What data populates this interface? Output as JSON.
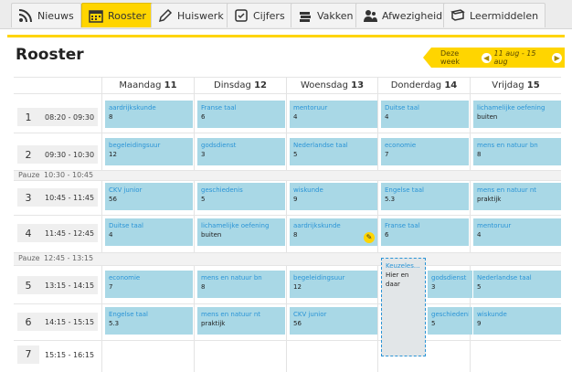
{
  "nav": {
    "tabs": [
      {
        "label": "Nieuws",
        "icon": "rss-icon"
      },
      {
        "label": "Rooster",
        "icon": "calendar-icon"
      },
      {
        "label": "Huiswerk",
        "icon": "pencil-icon"
      },
      {
        "label": "Cijfers",
        "icon": "checkmark-icon"
      },
      {
        "label": "Vakken",
        "icon": "books-icon"
      },
      {
        "label": "Afwezigheid",
        "icon": "users-icon"
      },
      {
        "label": "Leermiddelen",
        "icon": "book-icon"
      }
    ],
    "active": "Rooster"
  },
  "page": {
    "title": "Rooster"
  },
  "week": {
    "label": "Deze week",
    "range": "11 aug - 15 aug",
    "prev_icon": "chevron-left-icon",
    "next_icon": "chevron-right-icon"
  },
  "days": [
    {
      "name": "Maandag",
      "date": "11"
    },
    {
      "name": "Dinsdag",
      "date": "12"
    },
    {
      "name": "Woensdag",
      "date": "13"
    },
    {
      "name": "Donderdag",
      "date": "14"
    },
    {
      "name": "Vrijdag",
      "date": "15"
    }
  ],
  "hours": [
    {
      "num": "1",
      "time": "08:20 - 09:30"
    },
    {
      "num": "2",
      "time": "09:30 - 10:30"
    },
    {
      "num": "3",
      "time": "10:45 - 11:45"
    },
    {
      "num": "4",
      "time": "11:45 - 12:45"
    },
    {
      "num": "5",
      "time": "13:15 - 14:15"
    },
    {
      "num": "6",
      "time": "14:15 - 15:15"
    },
    {
      "num": "7",
      "time": "15:15 - 16:15"
    }
  ],
  "pauses": [
    {
      "label": "Pauze",
      "time": "10:30 - 10:45"
    },
    {
      "label": "Pauze",
      "time": "12:45 - 13:15"
    }
  ],
  "lessons": {
    "h1": [
      {
        "subject": "aardrijkskunde",
        "room": "8"
      },
      {
        "subject": "Franse taal",
        "room": "6"
      },
      {
        "subject": "mentoruur",
        "room": "4"
      },
      {
        "subject": "Duitse taal",
        "room": "4"
      },
      {
        "subject": "lichamelijke oefening",
        "room": "buiten"
      }
    ],
    "h2": [
      {
        "subject": "begeleidingsuur",
        "room": "12"
      },
      {
        "subject": "godsdienst",
        "room": "3"
      },
      {
        "subject": "Nederlandse taal",
        "room": "5"
      },
      {
        "subject": "economie",
        "room": "7"
      },
      {
        "subject": "mens en natuur bn",
        "room": "8"
      }
    ],
    "h3": [
      {
        "subject": "CKV junior",
        "room": "56"
      },
      {
        "subject": "geschiedenis",
        "room": "5"
      },
      {
        "subject": "wiskunde",
        "room": "9"
      },
      {
        "subject": "Engelse taal",
        "room": "5.3"
      },
      {
        "subject": "mens en natuur nt",
        "room": "praktijk"
      }
    ],
    "h4": [
      {
        "subject": "Duitse taal",
        "room": "4"
      },
      {
        "subject": "lichamelijke oefening",
        "room": "buiten"
      },
      {
        "subject": "aardrijkskunde",
        "room": "8"
      },
      {
        "subject": "Franse taal",
        "room": "6"
      },
      {
        "subject": "mentoruur",
        "room": "4"
      }
    ],
    "h5": [
      {
        "subject": "economie",
        "room": "7"
      },
      {
        "subject": "mens en natuur bn",
        "room": "8"
      },
      {
        "subject": "begeleidingsuur",
        "room": "12"
      },
      {
        "subject": "godsdienst",
        "room": "3"
      },
      {
        "subject": "Nederlandse taal",
        "room": "5"
      }
    ],
    "h6": [
      {
        "subject": "Engelse taal",
        "room": "5.3"
      },
      {
        "subject": "mens en natuur nt",
        "room": "praktijk"
      },
      {
        "subject": "CKV junior",
        "room": "56"
      },
      {
        "subject": "geschiedenis",
        "room": "5"
      },
      {
        "subject": "wiskunde",
        "room": "9"
      }
    ]
  },
  "keuze": {
    "subject": "Keuzeles...",
    "note": "Hier en daar"
  },
  "colors": {
    "accent": "#ffd500",
    "lesson_bg": "#a9d8e6",
    "subject_text": "#2a94d6"
  }
}
